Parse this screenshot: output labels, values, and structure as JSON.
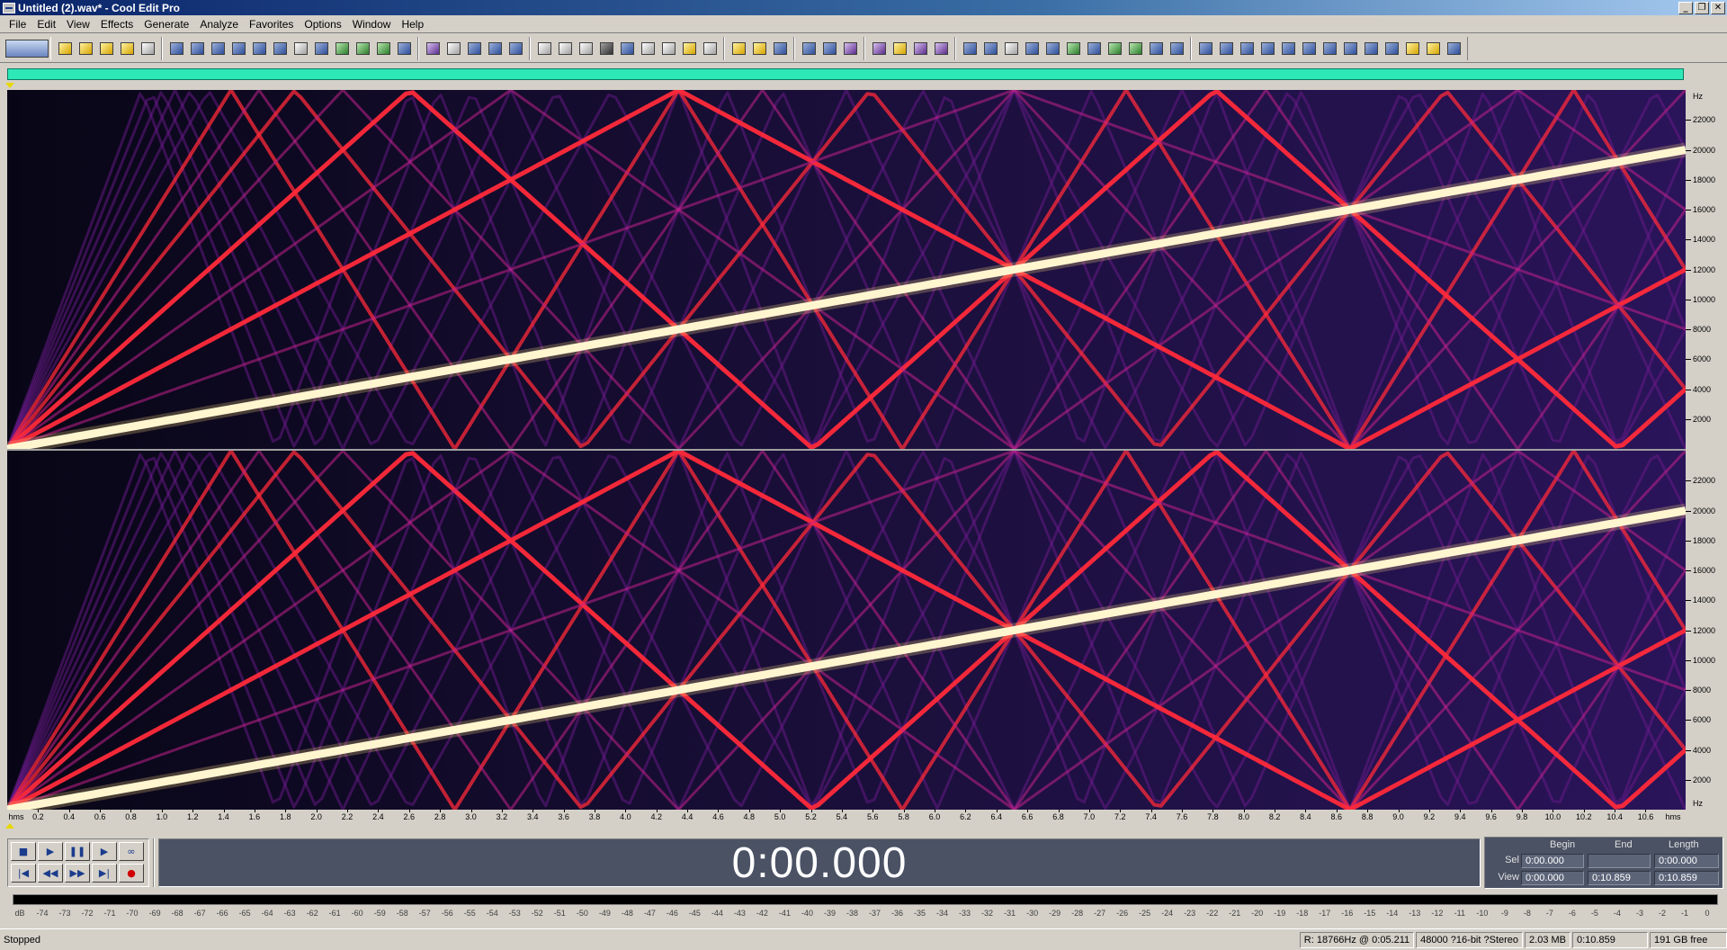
{
  "window": {
    "title": "Untitled (2).wav* - Cool Edit Pro",
    "minimize": "_",
    "restore": "❐",
    "close": "✕"
  },
  "menu": [
    "File",
    "Edit",
    "View",
    "Effects",
    "Generate",
    "Analyze",
    "Favorites",
    "Options",
    "Window",
    "Help"
  ],
  "toolbar": {
    "groups": [
      [
        "y",
        "y",
        "y",
        "y",
        "w"
      ],
      [
        "b",
        "b",
        "b",
        "b",
        "b",
        "b",
        "w",
        "b",
        "g",
        "g",
        "g",
        "b"
      ],
      [
        "p",
        "w",
        "b",
        "b",
        "b"
      ],
      [
        "w",
        "w",
        "w",
        "k",
        "b",
        "w",
        "w",
        "y",
        "w"
      ],
      [
        "y",
        "y",
        "b"
      ],
      [
        "b",
        "b",
        "p"
      ],
      [
        "p",
        "y",
        "p",
        "p"
      ],
      [
        "b",
        "b",
        "w",
        "b",
        "b",
        "g",
        "b",
        "g",
        "g",
        "b",
        "b"
      ],
      [
        "b",
        "b",
        "b",
        "b",
        "b",
        "b",
        "b",
        "b",
        "b",
        "b",
        "y",
        "y",
        "b"
      ]
    ]
  },
  "spectral": {
    "frequency_ruler": {
      "unit": "Hz",
      "labels": [
        "22000",
        "20000",
        "18000",
        "16000",
        "14000",
        "12000",
        "10000",
        "8000",
        "6000",
        "4000",
        "2000"
      ],
      "max_hz": 24000
    },
    "sweep": {
      "fundamental_end_hz": 20000,
      "duration_s": 10.859,
      "colors": {
        "background": "#0c0a24",
        "fundamental": "#fff6d0",
        "strong": "#ff2a3a",
        "medium": "#c0208a",
        "weak": "#6a1a8a"
      }
    }
  },
  "time_ruler": {
    "start_label": "hms",
    "end_label": "hms",
    "labels": [
      "0.2",
      "0.4",
      "0.6",
      "0.8",
      "1.0",
      "1.2",
      "1.4",
      "1.6",
      "1.8",
      "2.0",
      "2.2",
      "2.4",
      "2.6",
      "2.8",
      "3.0",
      "3.2",
      "3.4",
      "3.6",
      "3.8",
      "4.0",
      "4.2",
      "4.4",
      "4.6",
      "4.8",
      "5.0",
      "5.2",
      "5.4",
      "5.6",
      "5.8",
      "6.0",
      "6.2",
      "6.4",
      "6.6",
      "6.8",
      "7.0",
      "7.2",
      "7.4",
      "7.6",
      "7.8",
      "8.0",
      "8.2",
      "8.4",
      "8.6",
      "8.8",
      "9.0",
      "9.2",
      "9.4",
      "9.6",
      "9.8",
      "10.0",
      "10.2",
      "10.4",
      "10.6"
    ]
  },
  "transport": {
    "buttons": [
      {
        "name": "stop-button",
        "glyph": "■"
      },
      {
        "name": "play-button",
        "glyph": "▶"
      },
      {
        "name": "pause-button",
        "glyph": "❚❚"
      },
      {
        "name": "play-to-end-button",
        "glyph": "▶"
      },
      {
        "name": "loop-button",
        "glyph": "∞"
      },
      {
        "name": "go-to-start-button",
        "glyph": "|◀"
      },
      {
        "name": "rewind-button",
        "glyph": "◀◀"
      },
      {
        "name": "fast-forward-button",
        "glyph": "▶▶"
      },
      {
        "name": "go-to-end-button",
        "glyph": "▶|"
      },
      {
        "name": "record-button",
        "glyph": "●"
      }
    ]
  },
  "time_display": "0:00.000",
  "selection_view": {
    "headers": {
      "begin": "Begin",
      "end": "End",
      "length": "Length"
    },
    "sel": {
      "label": "Sel",
      "begin": "0:00.000",
      "end": "",
      "length": "0:00.000"
    },
    "view": {
      "label": "View",
      "begin": "0:00.000",
      "end": "0:10.859",
      "length": "0:10.859"
    }
  },
  "level_meter": {
    "labels": [
      "dB",
      "-74",
      "-73",
      "-72",
      "-71",
      "-70",
      "-69",
      "-68",
      "-67",
      "-66",
      "-65",
      "-64",
      "-63",
      "-62",
      "-61",
      "-60",
      "-59",
      "-58",
      "-57",
      "-56",
      "-55",
      "-54",
      "-53",
      "-52",
      "-51",
      "-50",
      "-49",
      "-48",
      "-47",
      "-46",
      "-45",
      "-44",
      "-43",
      "-42",
      "-41",
      "-40",
      "-39",
      "-38",
      "-37",
      "-36",
      "-35",
      "-34",
      "-33",
      "-32",
      "-31",
      "-30",
      "-29",
      "-28",
      "-27",
      "-26",
      "-25",
      "-24",
      "-23",
      "-22",
      "-21",
      "-20",
      "-19",
      "-18",
      "-17",
      "-16",
      "-15",
      "-14",
      "-13",
      "-12",
      "-11",
      "-10",
      "-9",
      "-8",
      "-7",
      "-6",
      "-5",
      "-4",
      "-3",
      "-2",
      "-1",
      "0"
    ]
  },
  "statusbar": {
    "state": "Stopped",
    "cursor_readout": "R: 18766Hz @  0:05.211",
    "format": "48000 ?16-bit ?Stereo",
    "size": "2.03 MB",
    "duration": "0:10.859",
    "free_space": "191 GB free"
  }
}
